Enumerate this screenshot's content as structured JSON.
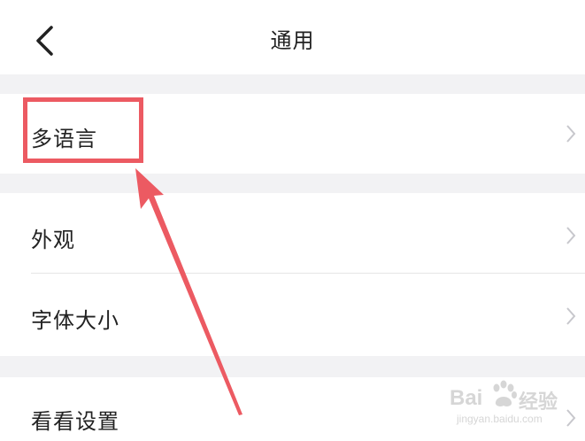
{
  "navbar": {
    "title": "通用",
    "back_icon": "chevron-left-icon"
  },
  "settings": {
    "items": [
      {
        "label": "多语言",
        "icon": "chevron-right-icon"
      },
      {
        "label": "外观",
        "icon": "chevron-right-icon"
      },
      {
        "label": "字体大小",
        "icon": "chevron-right-icon"
      },
      {
        "label": "看看设置",
        "icon": "chevron-right-icon"
      }
    ]
  },
  "annotation": {
    "color": "#ec5a62"
  },
  "watermark": {
    "brand": "Bai",
    "brand_tail": "经验",
    "url": "jingyan.baidu.com"
  },
  "colors": {
    "section_gap": "#f2f2f4",
    "text": "#222222",
    "chevron": "#c7c7cc"
  }
}
